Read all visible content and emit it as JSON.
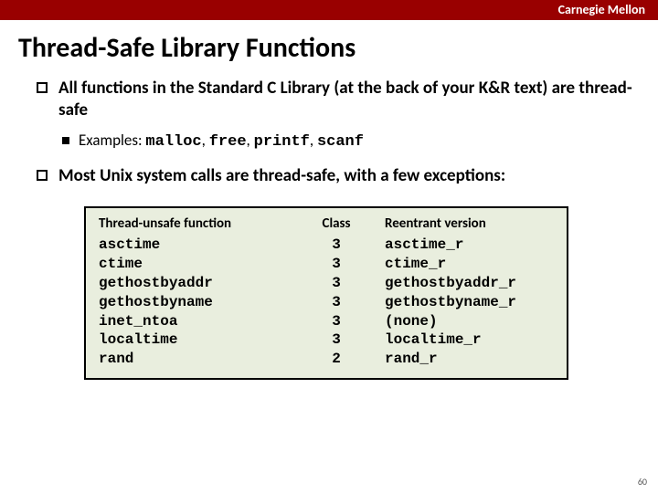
{
  "header": {
    "institution": "Carnegie Mellon"
  },
  "title": "Thread-Safe Library Functions",
  "bullets": {
    "b1": "All functions in the Standard C Library (at the back of your K&R text) are thread-safe",
    "b1_sub_prefix": "Examples: ",
    "b1_sub_codes": {
      "c1": "malloc",
      "c2": "free",
      "c3": "printf",
      "c4": "scanf"
    },
    "b2": "Most Unix system calls are thread-safe, with a few exceptions:"
  },
  "table": {
    "headers": {
      "func": "Thread-unsafe function",
      "class": "Class",
      "reent": "Reentrant version"
    },
    "rows": [
      {
        "func": "asctime",
        "class": "3",
        "reent": "asctime_r"
      },
      {
        "func": "ctime",
        "class": "3",
        "reent": "ctime_r"
      },
      {
        "func": "gethostbyaddr",
        "class": "3",
        "reent": "gethostbyaddr_r"
      },
      {
        "func": "gethostbyname",
        "class": "3",
        "reent": "gethostbyname_r"
      },
      {
        "func": "inet_ntoa",
        "class": "3",
        "reent": "(none)"
      },
      {
        "func": "localtime",
        "class": "3",
        "reent": "localtime_r"
      },
      {
        "func": "rand",
        "class": "2",
        "reent": "rand_r"
      }
    ]
  },
  "page_number": "60"
}
